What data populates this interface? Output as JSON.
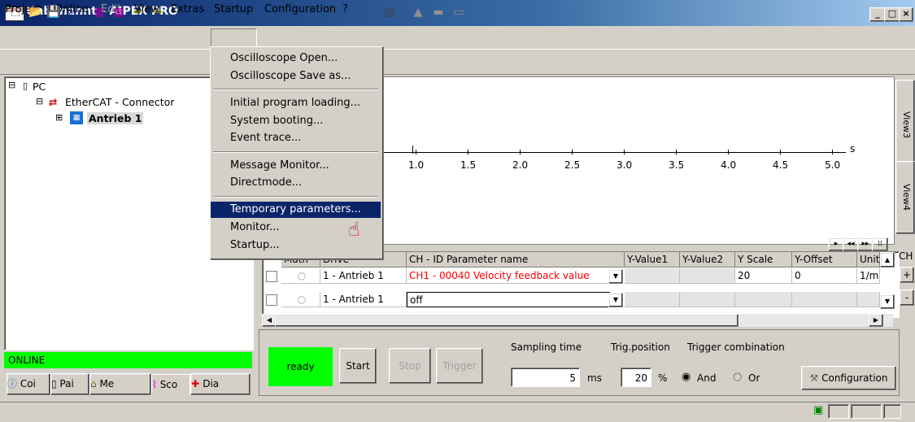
{
  "window": {
    "title": "Unbenannt - AIPEX PRO",
    "icon_text": "AIPEX",
    "min": "_",
    "max": "□",
    "close": "×"
  },
  "menu": [
    "Project",
    "Online",
    "Edit",
    "View",
    "Extras",
    "Startup",
    "Configuration",
    "?"
  ],
  "startup_menu": {
    "items": [
      "Oscilloscope Open...",
      "Oscilloscope Save as...",
      "Initial program loading...",
      "System booting...",
      "Event trace...",
      "Message Monitor...",
      "Directmode...",
      "Temporary parameters...",
      "Monitor...",
      "Startup..."
    ],
    "highlighted": "Temporary parameters..."
  },
  "tree": {
    "root": "PC",
    "child": "EtherCAT - Connector",
    "leaf": "Antrieb 1"
  },
  "status": {
    "online": "ONLINE"
  },
  "bottom_tabs": [
    "Coi",
    "Pai",
    "Me",
    "Sco",
    "Dia"
  ],
  "scope": {
    "axis_unit": "s",
    "ticks": [
      "1.0",
      "1.5",
      "2.0",
      "2.5",
      "3.0",
      "3.5",
      "4.0",
      "4.5",
      "5.0"
    ],
    "view_tabs": [
      "View3",
      "View4"
    ],
    "nav_buttons": [
      "▸",
      "◂◂",
      "▸▸",
      "⁞⁞"
    ]
  },
  "grid": {
    "headers": [
      "Math",
      "Drive",
      "CH - ID Parameter name",
      "Y-Value1",
      "Y-Value2",
      "Y Scale",
      "Y-Offset",
      "Unit"
    ],
    "rows": [
      {
        "drive": "1 - Antrieb 1",
        "param": "CH1 - 00040  Velocity feedback value",
        "y1": "",
        "y2": "",
        "scale": "20",
        "offset": "0",
        "unit": "1/m"
      },
      {
        "drive": "1 - Antrieb 1",
        "param": "off",
        "y1": "",
        "y2": "",
        "scale": "",
        "offset": "",
        "unit": ""
      }
    ],
    "ch_label": "CH",
    "plus": "+",
    "minus": "-"
  },
  "controls": {
    "ready": "ready",
    "start": "Start",
    "stop": "Stop",
    "trigger": "Trigger",
    "sampling_label": "Sampling time",
    "sampling_value": "5",
    "sampling_unit": "ms",
    "trig_pos_label": "Trig.position",
    "trig_pos_value": "20",
    "trig_pos_unit": "%",
    "trig_comb_label": "Trigger combination",
    "and": "And",
    "or": "Or",
    "configuration": "Configuration"
  },
  "colors": {
    "online": "#00ff00",
    "ready": "#00ff00",
    "highlight": "#0a246a",
    "param_red": "#ff0000"
  }
}
